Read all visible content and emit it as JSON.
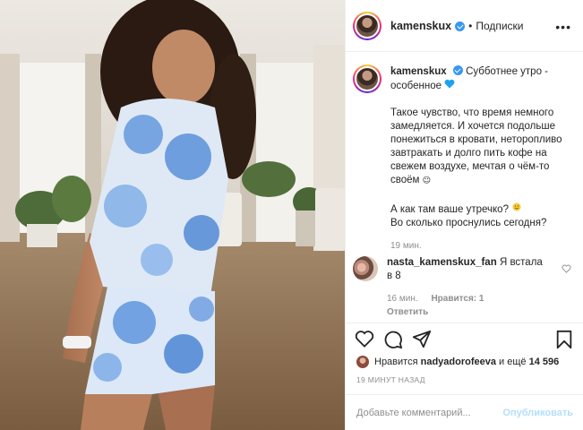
{
  "post": {
    "username": "kamenskux",
    "dot": "•",
    "follow_label": "Подписки",
    "more_label": "•••"
  },
  "caption": {
    "username": "kamenskux",
    "line1": "Субботнее утро -",
    "line2": "особенное",
    "para1": "Такое чувство, что время немного замедляется. И хочется подольше понежиться в кровати, неторопливо завтракать и долго пить кофе на свежем воздухе, мечтая о чём-то своём",
    "para1_emoji": "☺",
    "q1": "А как там ваше утречко?",
    "q1_emoji": "☺",
    "q2": "Во сколько проснулись сегодня?",
    "time": "19 мин."
  },
  "comment": {
    "username": "nasta_kamenskux_fan",
    "text": "Я встала в 8",
    "time": "16 мин.",
    "likes": "Нравится: 1",
    "reply": "Ответить"
  },
  "likes": {
    "prefix": "Нравится",
    "user": "nadyadorofeeva",
    "middle": "и ещё",
    "count": "14 596"
  },
  "timestamp": "19 МИНУТ НАЗАД",
  "add_comment": {
    "placeholder": "Добавьте комментарий...",
    "post_label": "Опубликовать"
  },
  "colors": {
    "accent_blue": "#3897f0",
    "post_disabled": "#b2dffc",
    "heart_emoji": "#1da1f2"
  }
}
